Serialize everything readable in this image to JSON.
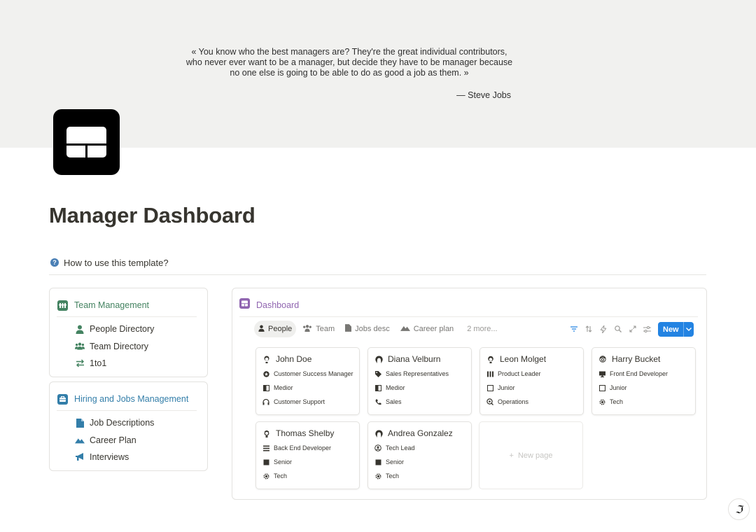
{
  "cover": {
    "quote": "« You know who the best managers are? They're the great individual contributors, who never ever want to be a manager, but decide they have to be manager because no one else is going to be able to do as good a job as them. »",
    "author": "— Steve Jobs"
  },
  "page": {
    "title": "Manager Dashboard",
    "howto": "How to use this template?"
  },
  "team_card": {
    "title": "Team Management",
    "items": [
      {
        "label": "People Directory",
        "icon": "person-icon"
      },
      {
        "label": "Team Directory",
        "icon": "group-icon"
      },
      {
        "label": "1to1",
        "icon": "arrows-swap-icon"
      }
    ]
  },
  "hiring_card": {
    "title": "Hiring and Jobs Management",
    "items": [
      {
        "label": "Job Descriptions",
        "icon": "document-icon"
      },
      {
        "label": "Career Plan",
        "icon": "mountain-icon"
      },
      {
        "label": "Interviews",
        "icon": "megaphone-icon"
      }
    ]
  },
  "dashboard": {
    "title": "Dashboard",
    "tabs": [
      {
        "label": "People",
        "icon": "person-icon",
        "active": true
      },
      {
        "label": "Team",
        "icon": "group-icon"
      },
      {
        "label": "Jobs desc",
        "icon": "document-icon"
      },
      {
        "label": "Career plan",
        "icon": "mountain-icon"
      }
    ],
    "more_tabs": "2 more...",
    "new_label": "New",
    "new_page_label": "New page",
    "people": [
      {
        "name": "John Doe",
        "role": "Customer Success Manager",
        "level": "Medior",
        "department": "Customer Support"
      },
      {
        "name": "Diana Velburn",
        "role": "Sales Representatives",
        "level": "Medior",
        "department": "Sales"
      },
      {
        "name": "Leon Molget",
        "role": "Product Leader",
        "level": "Junior",
        "department": "Operations"
      },
      {
        "name": "Harry Bucket",
        "role": "Front End Developer",
        "level": "Junior",
        "department": "Tech"
      },
      {
        "name": "Thomas Shelby",
        "role": "Back End Developer",
        "level": "Senior",
        "department": "Tech"
      },
      {
        "name": "Andrea Gonzalez",
        "role": "Tech Lead",
        "level": "Senior",
        "department": "Tech"
      }
    ]
  },
  "colors": {
    "accent_blue": "#2383e2",
    "team_green": "#448361",
    "hiring_blue": "#337ea9",
    "dashboard_purple": "#9065b0"
  }
}
